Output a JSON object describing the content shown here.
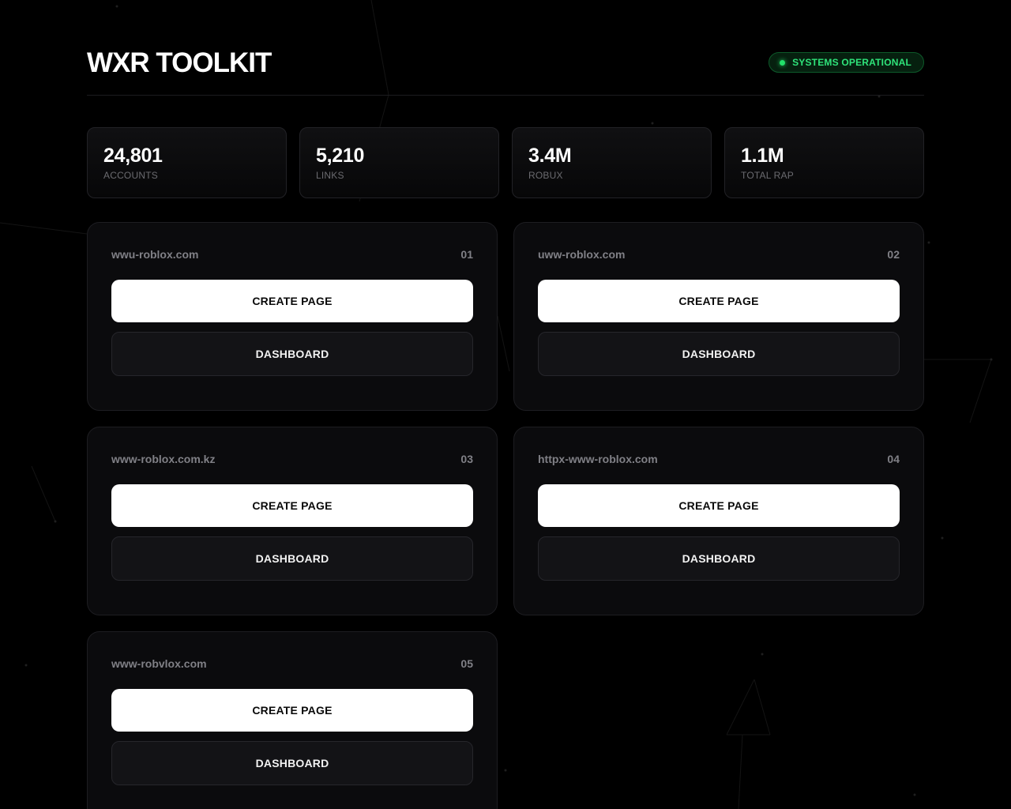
{
  "header": {
    "title": "WXR TOOLKIT",
    "status": "SYSTEMS OPERATIONAL",
    "status_color": "#22e06a"
  },
  "stats": [
    {
      "value": "24,801",
      "label": "ACCOUNTS"
    },
    {
      "value": "5,210",
      "label": "LINKS"
    },
    {
      "value": "3.4M",
      "label": "ROBUX"
    },
    {
      "value": "1.1M",
      "label": "TOTAL RAP"
    }
  ],
  "sites": [
    {
      "domain": "wwu-roblox.com",
      "number": "01",
      "create_label": "CREATE PAGE",
      "dashboard_label": "DASHBOARD"
    },
    {
      "domain": "uww-roblox.com",
      "number": "02",
      "create_label": "CREATE PAGE",
      "dashboard_label": "DASHBOARD"
    },
    {
      "domain": "www-roblox.com.kz",
      "number": "03",
      "create_label": "CREATE PAGE",
      "dashboard_label": "DASHBOARD"
    },
    {
      "domain": "httpx-www-roblox.com",
      "number": "04",
      "create_label": "CREATE PAGE",
      "dashboard_label": "DASHBOARD"
    },
    {
      "domain": "www-robvlox.com",
      "number": "05",
      "create_label": "CREATE PAGE",
      "dashboard_label": "DASHBOARD"
    }
  ]
}
